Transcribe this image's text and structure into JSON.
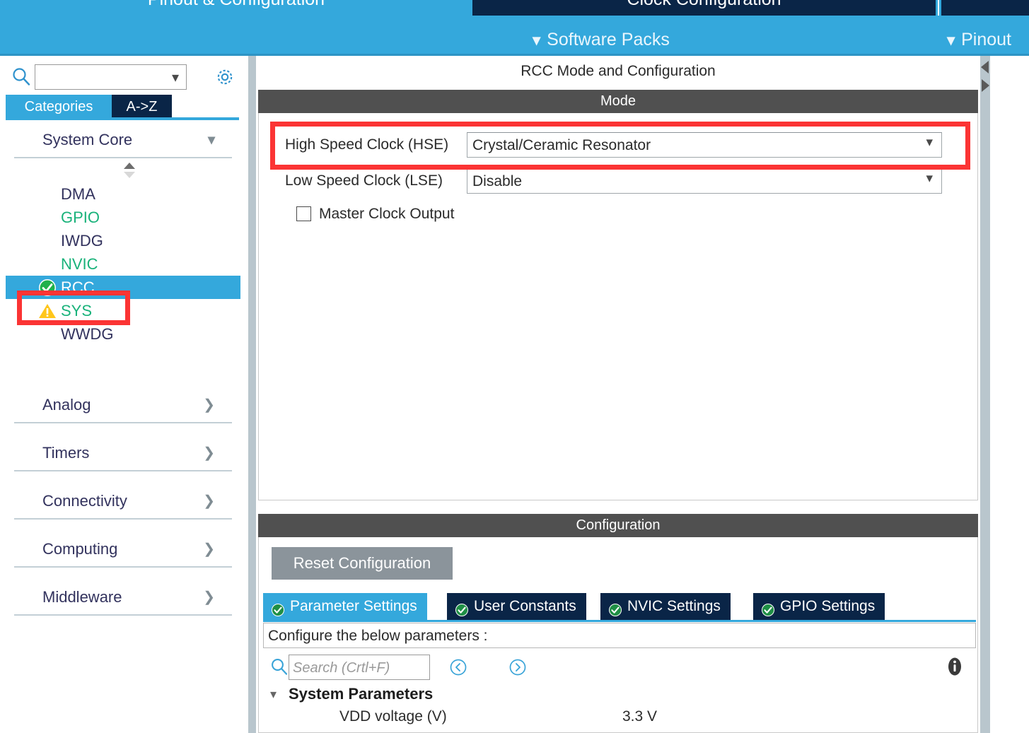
{
  "header": {
    "tabs": [
      {
        "label": "Pinout & Configuration",
        "active": true
      },
      {
        "label": "Clock Configuration",
        "active": false
      }
    ],
    "sub_items": [
      {
        "label": "Software Packs",
        "icon": "chevron-down-icon"
      },
      {
        "label": "Pinout",
        "icon": "chevron-down-icon"
      }
    ],
    "colors": {
      "accent": "#34a8dc",
      "dark": "#0a2547"
    }
  },
  "sidebar": {
    "search": {
      "value": "",
      "placeholder": ""
    },
    "gear_icon": "gear-icon",
    "tabs": [
      {
        "label": "Categories",
        "active": true
      },
      {
        "label": "A->Z",
        "active": false
      }
    ],
    "groups": [
      {
        "label": "System Core",
        "expanded": true,
        "arrow": "chevron-down-icon",
        "items": [
          {
            "label": "DMA",
            "state": "default",
            "badge": "none"
          },
          {
            "label": "GPIO",
            "state": "configured",
            "badge": "none"
          },
          {
            "label": "IWDG",
            "state": "default",
            "badge": "none"
          },
          {
            "label": "NVIC",
            "state": "configured",
            "badge": "none"
          },
          {
            "label": "RCC",
            "state": "selected",
            "badge": "check-icon"
          },
          {
            "label": "SYS",
            "state": "configured",
            "badge": "warning-icon"
          },
          {
            "label": "WWDG",
            "state": "default",
            "badge": "none"
          }
        ]
      },
      {
        "label": "Analog",
        "expanded": false,
        "arrow": "chevron-right-icon",
        "items": []
      },
      {
        "label": "Timers",
        "expanded": false,
        "arrow": "chevron-right-icon",
        "items": []
      },
      {
        "label": "Connectivity",
        "expanded": false,
        "arrow": "chevron-right-icon",
        "items": []
      },
      {
        "label": "Computing",
        "expanded": false,
        "arrow": "chevron-right-icon",
        "items": []
      },
      {
        "label": "Middleware",
        "expanded": false,
        "arrow": "chevron-right-icon",
        "items": []
      }
    ]
  },
  "main": {
    "title": "RCC Mode and Configuration",
    "mode": {
      "bar_label": "Mode",
      "fields": [
        {
          "label": "High Speed Clock (HSE)",
          "value": "Crystal/Ceramic Resonator",
          "caret": "chevron-down-icon"
        },
        {
          "label": "Low Speed Clock (LSE)",
          "value": "Disable",
          "caret": "chevron-down-icon"
        }
      ],
      "checkbox": {
        "label": "Master Clock Output",
        "checked": false
      }
    },
    "configuration": {
      "bar_label": "Configuration",
      "reset_button": "Reset Configuration",
      "tabs": [
        {
          "label": "Parameter Settings",
          "active": true,
          "icon": "check-icon"
        },
        {
          "label": "User Constants",
          "active": false,
          "icon": "check-icon"
        },
        {
          "label": "NVIC Settings",
          "active": false,
          "icon": "check-icon"
        },
        {
          "label": "GPIO Settings",
          "active": false,
          "icon": "check-icon"
        }
      ],
      "note": "Configure the below parameters :",
      "search": {
        "value": "",
        "placeholder": "Search (Crtl+F)",
        "icon": "search-icon"
      },
      "nav_prev_icon": "chevron-left-circle-icon",
      "nav_next_icon": "chevron-right-circle-icon",
      "info_icon": "info-icon",
      "tree": [
        {
          "group": "System Parameters",
          "twisty": "chevron-down-icon",
          "rows": [
            {
              "key": "VDD voltage (V)",
              "value": "3.3 V"
            }
          ]
        }
      ]
    }
  },
  "annotations": {
    "color": "#fb3434",
    "boxes": [
      {
        "name": "hse-highlight",
        "target": "High Speed Clock (HSE)"
      },
      {
        "name": "rcc-highlight",
        "target": "RCC"
      }
    ]
  },
  "splitters": {
    "left_collapse_icon": "triangle-left-icon",
    "right_collapse_icon": "triangle-right-icon"
  }
}
